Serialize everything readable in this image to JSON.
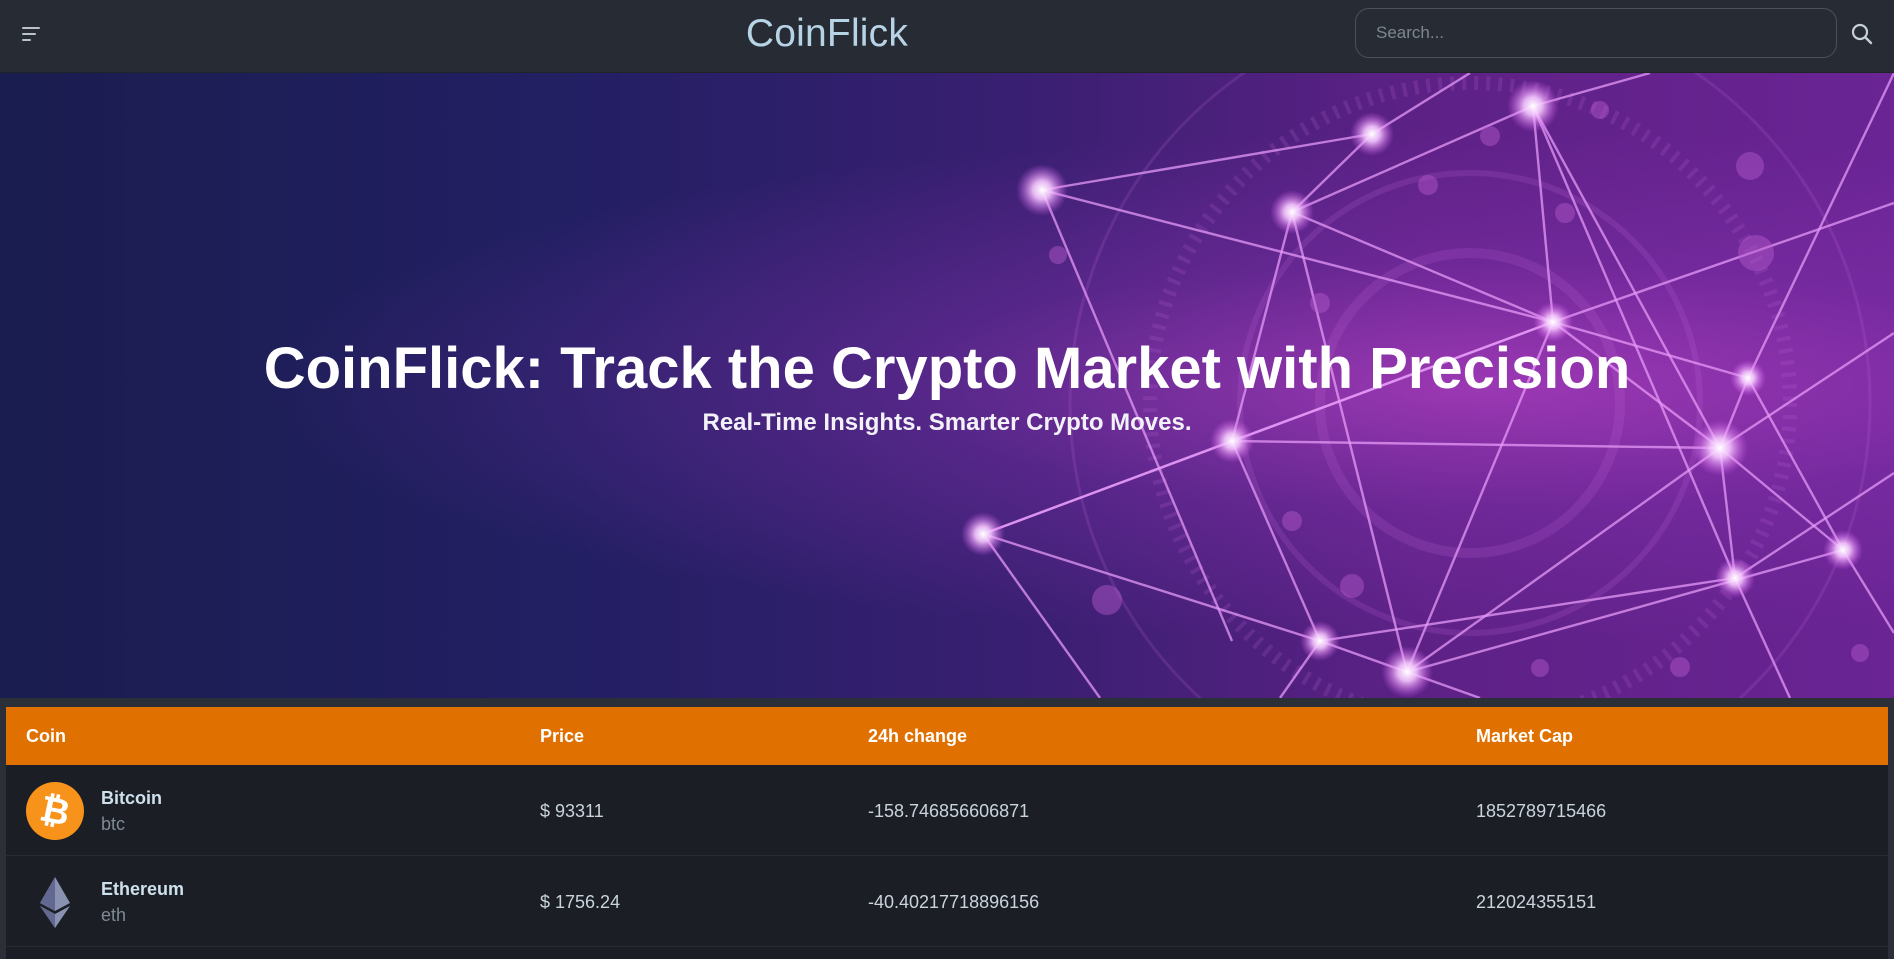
{
  "navbar": {
    "brand": "CoinFlick",
    "search_placeholder": "Search..."
  },
  "hero": {
    "title": "CoinFlick: Track the Crypto Market with Precision",
    "subtitle": "Real-Time Insights. Smarter Crypto Moves."
  },
  "table": {
    "headers": [
      "Coin",
      "Price",
      "24h change",
      "Market Cap"
    ],
    "rows": [
      {
        "name": "Bitcoin",
        "symbol": "btc",
        "price": "$ 93311",
        "change": "-158.746856606871",
        "market_cap": "1852789715466",
        "icon": "bitcoin-icon"
      },
      {
        "name": "Ethereum",
        "symbol": "eth",
        "price": "$ 1756.24",
        "change": "-40.40217718896156",
        "market_cap": "212024355151",
        "icon": "ethereum-icon"
      }
    ]
  },
  "colors": {
    "header_bg": "#e07000",
    "navbar_bg": "#272c34",
    "brand": "#b7d3e6",
    "bitcoin": "#f7931a"
  }
}
